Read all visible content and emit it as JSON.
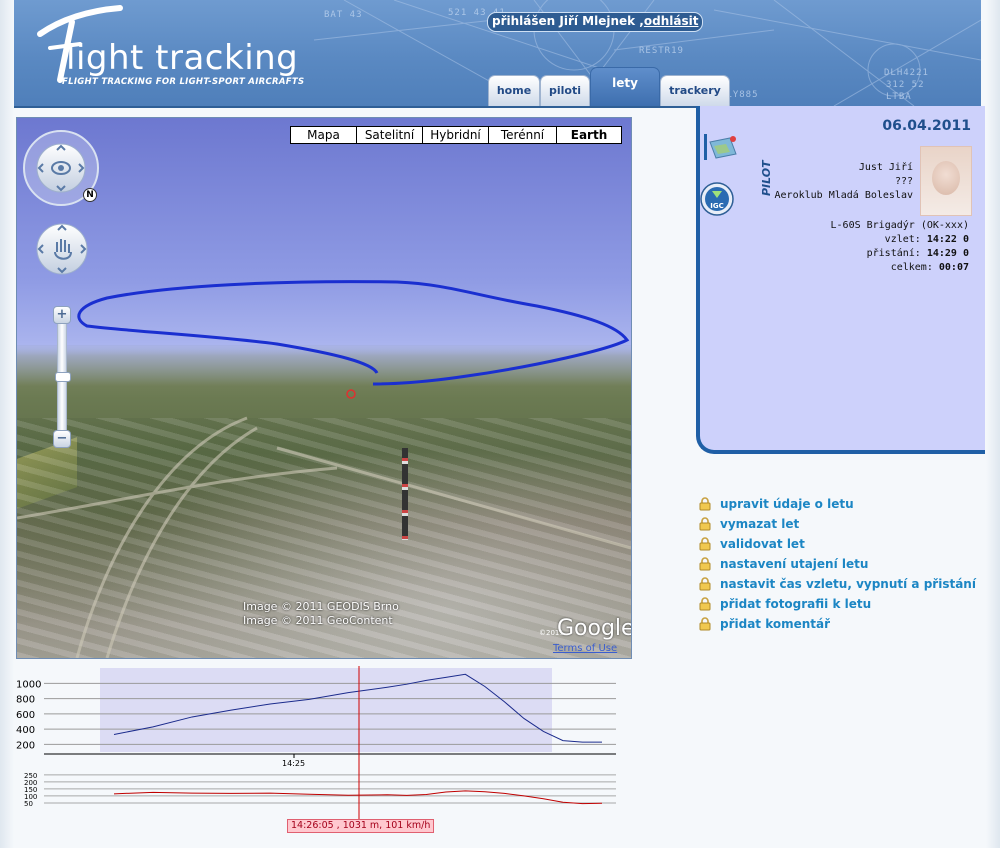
{
  "header": {
    "logo_title": "light tracking",
    "logo_subtitle": "FLIGHT TRACKING FOR LIGHT-SPORT AIRCRAFTS",
    "login_prefix": "přihlášen Jiří Mlejnek ,",
    "logout_label": "odhlásit",
    "background_labels": [
      "521 43 41",
      "RESTR19",
      "DLH4221",
      "312 52",
      "LTBA",
      "ELY885",
      "BAT 43"
    ],
    "tabs": [
      {
        "label": "home"
      },
      {
        "label": "piloti"
      },
      {
        "label": "lety",
        "active": true
      },
      {
        "label": "trackery"
      }
    ]
  },
  "map": {
    "type_buttons": [
      {
        "label": "Mapa"
      },
      {
        "label": "Satelitní"
      },
      {
        "label": "Hybridní"
      },
      {
        "label": "Terénní"
      },
      {
        "label": "Earth",
        "active": true
      }
    ],
    "copyright_1": "Image © 2011 GEODIS Brno",
    "copyright_2": "Image © 2011 GeoContent",
    "brand_year": "©2011",
    "brand": "Google",
    "terms": "Terms of Use",
    "compass_letter": "N",
    "zoom_in": "+",
    "zoom_out": "−",
    "track_color": "#1a2fd0"
  },
  "flight": {
    "date": "06.04.2011",
    "pilot_label": "PILOT",
    "pilot_name": "Just Jiří",
    "pilot_extra": "???",
    "club": "Aeroklub Mladá Boleslav",
    "aircraft": "L-60S Brigadýr (OK-xxx)",
    "takeoff_label": "vzlet:",
    "takeoff_time": "14:22",
    "landing_label": "přistání:",
    "landing_time": "14:29",
    "total_label": "celkem:",
    "total_time": "00:07",
    "igc_label": "IGC"
  },
  "actions": [
    {
      "label": "upravit údaje o letu"
    },
    {
      "label": "vymazat let"
    },
    {
      "label": "validovat let"
    },
    {
      "label": "nastavení utajení letu"
    },
    {
      "label": "nastavit čas vzletu, vypnutí a přistání"
    },
    {
      "label": "přidat fotografii k letu"
    },
    {
      "label": "přidat komentář"
    }
  ],
  "profile": {
    "altitude_ticks": [
      "1000",
      "800",
      "600",
      "400",
      "200"
    ],
    "speed_ticks": [
      "250",
      "200",
      "150",
      "100",
      "50"
    ],
    "time_tick": "14:25",
    "readout": "14:26:05 , 1031 m, 101 km/h",
    "altitude_color": "#1b2b8c",
    "speed_color": "#c00000",
    "cursor_color": "#d00000",
    "selection_color": "#dcdcf4"
  },
  "chart_data": {
    "type": "line",
    "xlabel": "",
    "ylabel": "",
    "series": [
      {
        "x": [
          0,
          40,
          80,
          120,
          160,
          200,
          240,
          280,
          300,
          320,
          340,
          360,
          380,
          400,
          420,
          440,
          460,
          480,
          500
        ],
        "values": [
          330,
          430,
          560,
          650,
          730,
          790,
          880,
          950,
          990,
          1040,
          1080,
          1120,
          960,
          760,
          540,
          370,
          250,
          230,
          230
        ]
      },
      {
        "x": [
          0,
          40,
          80,
          120,
          160,
          200,
          240,
          280,
          300,
          320,
          340,
          360,
          380,
          400,
          420,
          440,
          460,
          480,
          500
        ],
        "values": [
          115,
          125,
          120,
          118,
          120,
          112,
          105,
          108,
          104,
          110,
          128,
          136,
          130,
          118,
          100,
          80,
          55,
          45,
          48
        ]
      }
    ],
    "altitude_ylim": [
      100,
      1150
    ],
    "speed_ylim": [
      0,
      270
    ],
    "grid": true,
    "legend": "none"
  }
}
